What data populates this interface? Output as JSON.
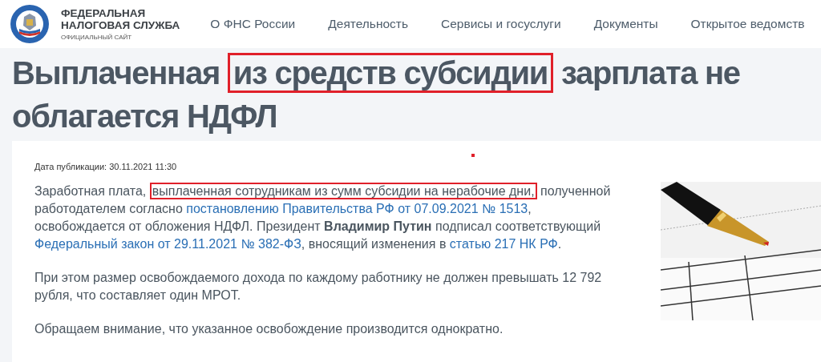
{
  "header": {
    "logo": {
      "line_1": "ФЕДЕРАЛЬНАЯ",
      "line_2": "НАЛОГОВАЯ СЛУЖБА",
      "subtitle": "ОФИЦИАЛЬНЫЙ САЙТ"
    },
    "nav": [
      "О ФНС России",
      "Деятельность",
      "Сервисы и госуслуги",
      "Документы",
      "Открытое ведомств"
    ]
  },
  "title": [
    {
      "kind": "text",
      "text": "Выплаченная "
    },
    {
      "kind": "highlight",
      "text": "из средств субсидии"
    },
    {
      "kind": "text",
      "text": " зарплата не облагается НДФЛ"
    }
  ],
  "article": {
    "date": "Дата публикации: 30.11.2021 11:30",
    "paragraphs": [
      [
        {
          "kind": "text",
          "text": "Заработная плата, "
        },
        {
          "kind": "highlight",
          "text": "выплаченная сотрудникам из сумм субсидии на нерабочие дни,"
        },
        {
          "kind": "text",
          "text": " полученной работодателем согласно "
        },
        {
          "kind": "link",
          "text": "постановлению Правительства РФ от 07.09.2021 № 1513"
        },
        {
          "kind": "text",
          "text": ", освобождается от обложения НДФЛ. Президент "
        },
        {
          "kind": "bold",
          "text": "Владимир Путин"
        },
        {
          "kind": "text",
          "text": " подписал соответствующий "
        },
        {
          "kind": "link",
          "text": "Федеральный закон от 29.11.2021 № 382-ФЗ"
        },
        {
          "kind": "text",
          "text": ", вносящий изменения в "
        },
        {
          "kind": "link",
          "text": "статью 217 НК РФ"
        },
        {
          "kind": "text",
          "text": "."
        }
      ],
      [
        {
          "kind": "text",
          "text": "При этом размер освобождаемого дохода по каждому работнику не должен превышать 12 792 рубля, что составляет один МРОТ."
        }
      ],
      [
        {
          "kind": "text",
          "text": "Обращаем внимание, что указанное освобождение производится однократно."
        }
      ]
    ]
  }
}
